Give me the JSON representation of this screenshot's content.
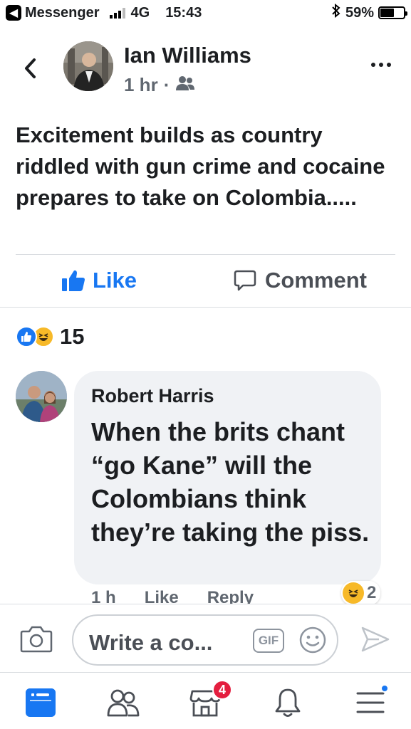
{
  "status_bar": {
    "app_back": "Messenger",
    "network": "4G",
    "time": "15:43",
    "battery": "59%",
    "battery_level": 0.59
  },
  "post": {
    "author": "Ian Williams",
    "time": "1 hr",
    "separator": "·",
    "privacy_icon": "friends-icon",
    "text": "Excitement builds as country riddled with gun crime and cocaine prepares to take on Colombia.....",
    "actions": {
      "like": "Like",
      "comment": "Comment"
    },
    "reactions": {
      "types": [
        "like",
        "haha"
      ],
      "count": "15"
    }
  },
  "comment": {
    "author": "Robert Harris",
    "text": "When the brits chant “go Kane” will the Colombians think they’re taking the piss.",
    "meta": {
      "time": "1 h",
      "like": "Like",
      "reply": "Reply"
    },
    "reaction": {
      "type": "haha",
      "count": "2"
    }
  },
  "composer": {
    "placeholder": "Write a co...",
    "gif": "GIF"
  },
  "tab_bar": {
    "tabs": [
      "news-feed-icon",
      "friends-icon",
      "marketplace-icon",
      "notifications-icon",
      "menu-icon"
    ],
    "marketplace_badge": "4"
  },
  "colors": {
    "accent": "#1877f2",
    "badge": "#e41e3f",
    "bubble": "#f0f2f5",
    "haha": "#f7b928"
  }
}
